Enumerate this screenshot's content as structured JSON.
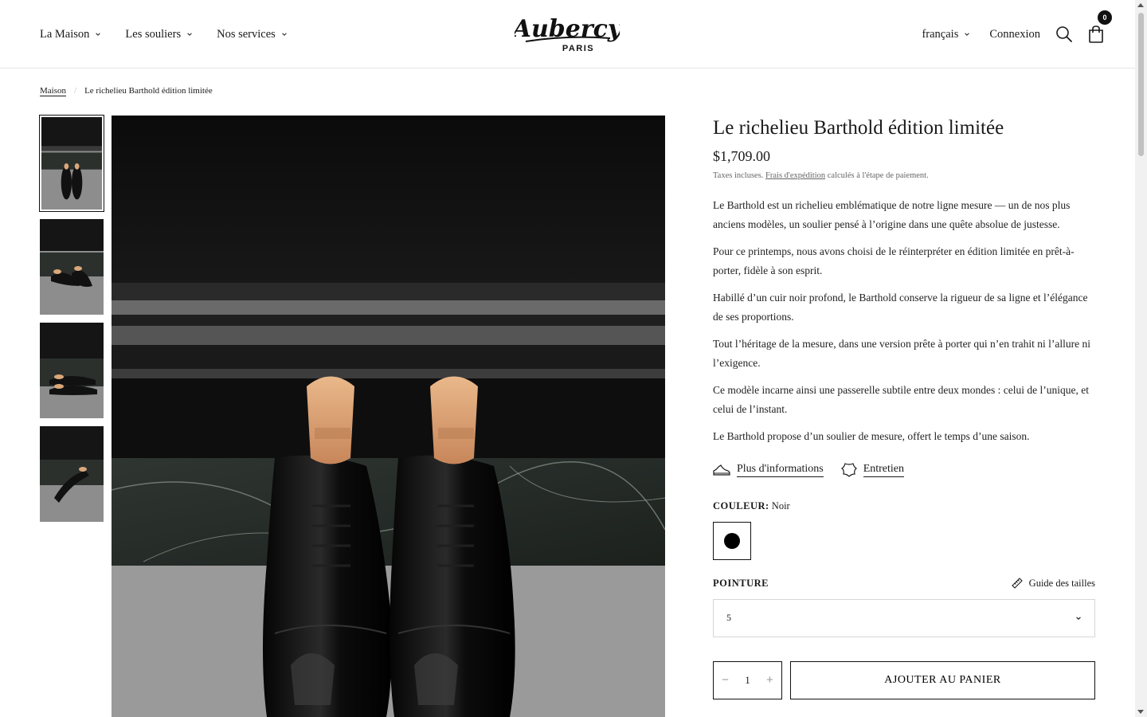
{
  "header": {
    "nav": [
      {
        "label": "La Maison"
      },
      {
        "label": "Les souliers"
      },
      {
        "label": "Nos services"
      }
    ],
    "logo_text": "Aubercy",
    "logo_sub": "PARIS",
    "language": "français",
    "login": "Connexion",
    "cart_count": "0"
  },
  "breadcrumb": {
    "home": "Maison",
    "current": "Le richelieu Barthold édition limitée"
  },
  "product": {
    "title": "Le richelieu Barthold édition limitée",
    "price": "$1,709.00",
    "tax_prefix": "Taxes incluses.",
    "tax_link": "Frais d'expédition",
    "tax_suffix": "calculés à l'étape de paiement.",
    "description": [
      "Le Barthold est un richelieu emblématique de notre ligne mesure — un de nos plus anciens modèles, un soulier pensé à l’origine dans une quête absolue de justesse.",
      "Pour ce printemps, nous avons choisi de le réinterpréter en édition limitée en prêt-à-porter, fidèle à son esprit.",
      "Habillé d’un cuir noir profond, le Barthold conserve la rigueur de sa ligne et l’élégance de ses proportions.",
      "Tout l’héritage de la mesure, dans une version prête à porter qui n’en trahit ni l’allure ni l’exigence.",
      "Ce modèle incarne ainsi une passerelle subtile entre deux mondes : celui de l’unique, et celui de l’instant.",
      "Le Barthold propose d’un soulier de mesure, offert le temps d’une saison."
    ],
    "more_info": "Plus d'informations",
    "care": "Entretien",
    "color_label": "COULEUR:",
    "color_value": "Noir",
    "color_hex": "#000000",
    "size_label": "POINTURE",
    "size_guide": "Guide des tailles",
    "size_value": "5",
    "quantity": "1",
    "qty_minus": "−",
    "qty_plus": "+",
    "add_to_cart": "AJOUTER AU PANIER"
  },
  "icons": {
    "nav_chevron": "chevron-down-icon",
    "search": "search-icon",
    "cart": "cart-icon",
    "shoe": "shoe-icon",
    "care": "leather-icon",
    "ruler": "ruler-icon"
  }
}
